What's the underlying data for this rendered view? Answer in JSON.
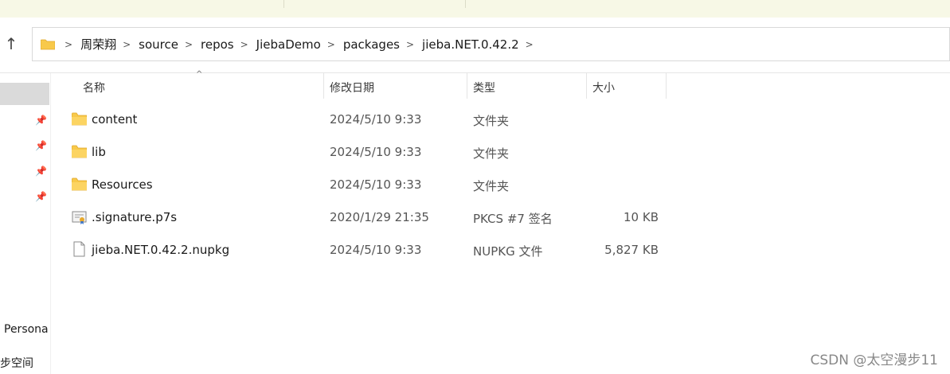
{
  "ribbon": {},
  "address_bar": {
    "crumbs": [
      "周荣翔",
      "source",
      "repos",
      "JiebaDemo",
      "packages",
      "jieba.NET.0.42.2"
    ]
  },
  "nav_pane": {
    "item_personal": "Persona",
    "item_sync": "步空间"
  },
  "columns": {
    "name": "名称",
    "date": "修改日期",
    "type": "类型",
    "size": "大小"
  },
  "files": [
    {
      "name": "content",
      "date": "2024/5/10 9:33",
      "type": "文件夹",
      "size": "",
      "icon": "folder-icon"
    },
    {
      "name": "lib",
      "date": "2024/5/10 9:33",
      "type": "文件夹",
      "size": "",
      "icon": "folder-icon"
    },
    {
      "name": "Resources",
      "date": "2024/5/10 9:33",
      "type": "文件夹",
      "size": "",
      "icon": "folder-icon"
    },
    {
      "name": ".signature.p7s",
      "date": "2020/1/29 21:35",
      "type": "PKCS #7 签名",
      "size": "10 KB",
      "icon": "certificate-icon"
    },
    {
      "name": "jieba.NET.0.42.2.nupkg",
      "date": "2024/5/10 9:33",
      "type": "NUPKG 文件",
      "size": "5,827 KB",
      "icon": "file-icon"
    }
  ],
  "watermark": "CSDN @太空漫步11",
  "colors": {
    "folder": "#f8c94a",
    "folder_dark": "#e8a92c",
    "selection": "#dadada"
  }
}
